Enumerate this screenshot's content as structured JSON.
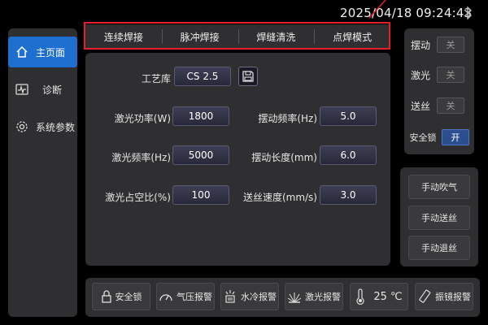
{
  "status_bar": {
    "datetime": "2025/04/18 09:24:43",
    "bluetooth_icon": "bluetooth-icon"
  },
  "nav": {
    "items": [
      {
        "label": "主页面",
        "icon": "home-icon",
        "active": true
      },
      {
        "label": "诊断",
        "icon": "pulse-icon",
        "active": false
      },
      {
        "label": "系统参数",
        "icon": "gear-icon",
        "active": false
      }
    ]
  },
  "tabs": [
    "连续焊接",
    "脉冲焊接",
    "焊缝清洗",
    "点焊模式"
  ],
  "process": {
    "label": "工艺库",
    "value": "CS 2.5"
  },
  "params": {
    "laser_power": {
      "label": "激光功率(W)",
      "value": "1800"
    },
    "laser_freq": {
      "label": "激光频率(Hz)",
      "value": "5000"
    },
    "duty": {
      "label": "激光占空比(%)",
      "value": "100"
    },
    "swing_freq": {
      "label": "摆动频率(Hz)",
      "value": "5.0"
    },
    "swing_len": {
      "label": "摆动长度(mm)",
      "value": "6.0"
    },
    "feed_speed": {
      "label": "送丝速度(mm/s)",
      "value": "3.0"
    }
  },
  "toggles": [
    {
      "label": "摆动",
      "state": "关",
      "on": false
    },
    {
      "label": "激光",
      "state": "关",
      "on": false
    },
    {
      "label": "送丝",
      "state": "关",
      "on": false
    },
    {
      "label": "安全锁",
      "state": "开",
      "on": true
    }
  ],
  "manual": [
    "手动吹气",
    "手动送丝",
    "手动退丝"
  ],
  "alarms": [
    {
      "label": "安全锁",
      "icon": "lock-icon"
    },
    {
      "label": "气压报警",
      "icon": "gauge-icon"
    },
    {
      "label": "水冷报警",
      "icon": "water-cooler-icon"
    },
    {
      "label": "激光报警",
      "icon": "laser-icon"
    },
    {
      "label": "25 ℃",
      "icon": "thermometer-icon"
    },
    {
      "label": "振镜报警",
      "icon": "galvo-icon"
    }
  ],
  "colors": {
    "accent": "#1e6fd0",
    "highlight_border": "#e5202a",
    "panel": "#2f2f31",
    "background": "#000000"
  }
}
